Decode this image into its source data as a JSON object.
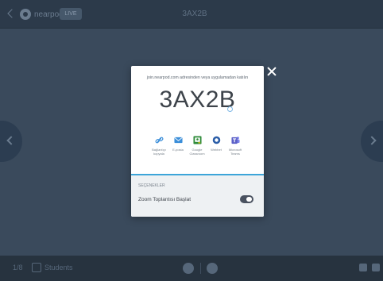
{
  "modal": {
    "join_text": "join.nearpod.com adresinden veya uygulamadan katılın",
    "code": "3AX2B",
    "share_options": [
      {
        "label": "Bağlantıyı kopyala",
        "icon": "link-icon",
        "color": "#3b8ed9"
      },
      {
        "label": "E-posta",
        "icon": "envelope-icon",
        "color": "#3b8ed9"
      },
      {
        "label": "Google Classroom",
        "icon": "google-classroom-icon",
        "color": "#2e8b3a"
      },
      {
        "label": "Webhet",
        "icon": "webhet-icon",
        "color": "#2c5ea8"
      },
      {
        "label": "Microsoft Teams",
        "icon": "teams-icon",
        "color": "#5b5fc7"
      }
    ],
    "options_title": "SEÇENEKLER",
    "zoom_label": "Zoom Toplantısı Başlat",
    "toggle_on": true
  },
  "colors": {
    "accent": "#3da5d9",
    "backdrop": "#3a4a5c",
    "bar": "#2c3a4a"
  }
}
